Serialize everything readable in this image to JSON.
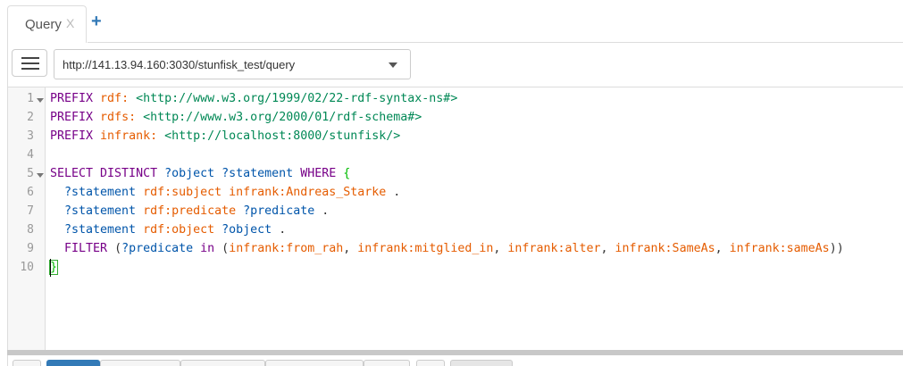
{
  "tabs": [
    {
      "label": "Query",
      "close": "X"
    }
  ],
  "add_tab": "+",
  "endpoint": {
    "value": "http://141.13.94.160:3030/stunfisk_test/query"
  },
  "line_numbers": [
    "1",
    "2",
    "3",
    "4",
    "5",
    "6",
    "7",
    "8",
    "9",
    "10"
  ],
  "code": [
    [
      {
        "t": "PREFIX ",
        "c": "kw"
      },
      {
        "t": "rdf: ",
        "c": "pfx"
      },
      {
        "t": "<http://www.w3.org/1999/02/22-rdf-syntax-ns#>",
        "c": "uri"
      }
    ],
    [
      {
        "t": "PREFIX ",
        "c": "kw"
      },
      {
        "t": "rdfs: ",
        "c": "pfx"
      },
      {
        "t": "<http://www.w3.org/2000/01/rdf-schema#>",
        "c": "uri"
      }
    ],
    [
      {
        "t": "PREFIX ",
        "c": "kw"
      },
      {
        "t": "infrank: ",
        "c": "pfx"
      },
      {
        "t": "<http://localhost:8000/stunfisk/>",
        "c": "uri"
      }
    ],
    [],
    [
      {
        "t": "SELECT DISTINCT ",
        "c": "kw"
      },
      {
        "t": "?object ?statement ",
        "c": "var"
      },
      {
        "t": "WHERE ",
        "c": "kw"
      },
      {
        "t": "{",
        "c": "brace"
      }
    ],
    [
      {
        "t": "  ?statement ",
        "c": "var"
      },
      {
        "t": "rdf:subject ",
        "c": "pfx"
      },
      {
        "t": "infrank:Andreas_Starke ",
        "c": "pfx"
      },
      {
        "t": ".",
        "c": "txt"
      }
    ],
    [
      {
        "t": "  ?statement ",
        "c": "var"
      },
      {
        "t": "rdf:predicate ",
        "c": "pfx"
      },
      {
        "t": "?predicate ",
        "c": "var"
      },
      {
        "t": ".",
        "c": "txt"
      }
    ],
    [
      {
        "t": "  ?statement ",
        "c": "var"
      },
      {
        "t": "rdf:object ",
        "c": "pfx"
      },
      {
        "t": "?object ",
        "c": "var"
      },
      {
        "t": ".",
        "c": "txt"
      }
    ],
    [
      {
        "t": "  FILTER ",
        "c": "kw"
      },
      {
        "t": "(",
        "c": "txt"
      },
      {
        "t": "?predicate ",
        "c": "var"
      },
      {
        "t": "in ",
        "c": "kw"
      },
      {
        "t": "(",
        "c": "txt"
      },
      {
        "t": "infrank:from_rah",
        "c": "pfx"
      },
      {
        "t": ", ",
        "c": "txt"
      },
      {
        "t": "infrank:mitglied_in",
        "c": "pfx"
      },
      {
        "t": ", ",
        "c": "txt"
      },
      {
        "t": "infrank:alter",
        "c": "pfx"
      },
      {
        "t": ", ",
        "c": "txt"
      },
      {
        "t": "infrank:SameAs",
        "c": "pfx"
      },
      {
        "t": ", ",
        "c": "txt"
      },
      {
        "t": "infrank:sameAs",
        "c": "pfx"
      },
      {
        "t": "))",
        "c": "txt"
      }
    ],
    [
      {
        "t": "}",
        "c": "brace bracket-match"
      }
    ]
  ],
  "colors": {
    "keyword": "#770088",
    "prefix": "#e55c00",
    "uri": "#008855",
    "variable": "#0055aa",
    "brace": "#00bb00"
  },
  "icons": {
    "menu": "hamburger-icon",
    "dropdown": "chevron-down-icon"
  }
}
